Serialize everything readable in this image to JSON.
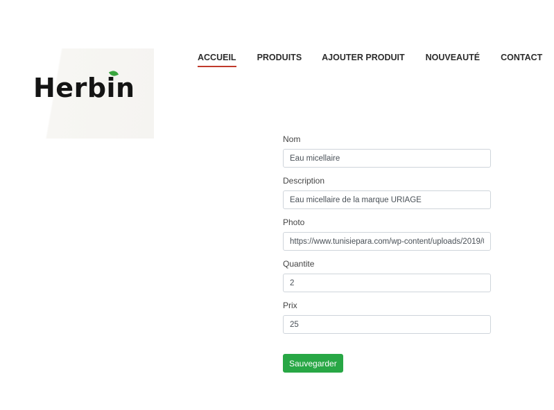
{
  "brand": {
    "logo_text": "Herbin",
    "leaf_color": "#3aa63f"
  },
  "nav": {
    "items": [
      {
        "label": "ACCUEIL",
        "active": true
      },
      {
        "label": "PRODUITS",
        "active": false
      },
      {
        "label": "AJOUTER PRODUIT",
        "active": false
      },
      {
        "label": "NOUVEAUTÉ",
        "active": false
      },
      {
        "label": "CONTACT",
        "active": false
      }
    ],
    "active_underline_color": "#c0392b"
  },
  "form": {
    "fields": [
      {
        "label": "Nom",
        "value": "Eau micellaire"
      },
      {
        "label": "Description",
        "value": "Eau micellaire de la marque URIAGE"
      },
      {
        "label": "Photo",
        "value": "https://www.tunisiepara.com/wp-content/uploads/2019/0"
      },
      {
        "label": "Quantite",
        "value": "2"
      },
      {
        "label": "Prix",
        "value": "25"
      }
    ],
    "save_label": "Sauvegarder",
    "save_color": "#28a745"
  }
}
